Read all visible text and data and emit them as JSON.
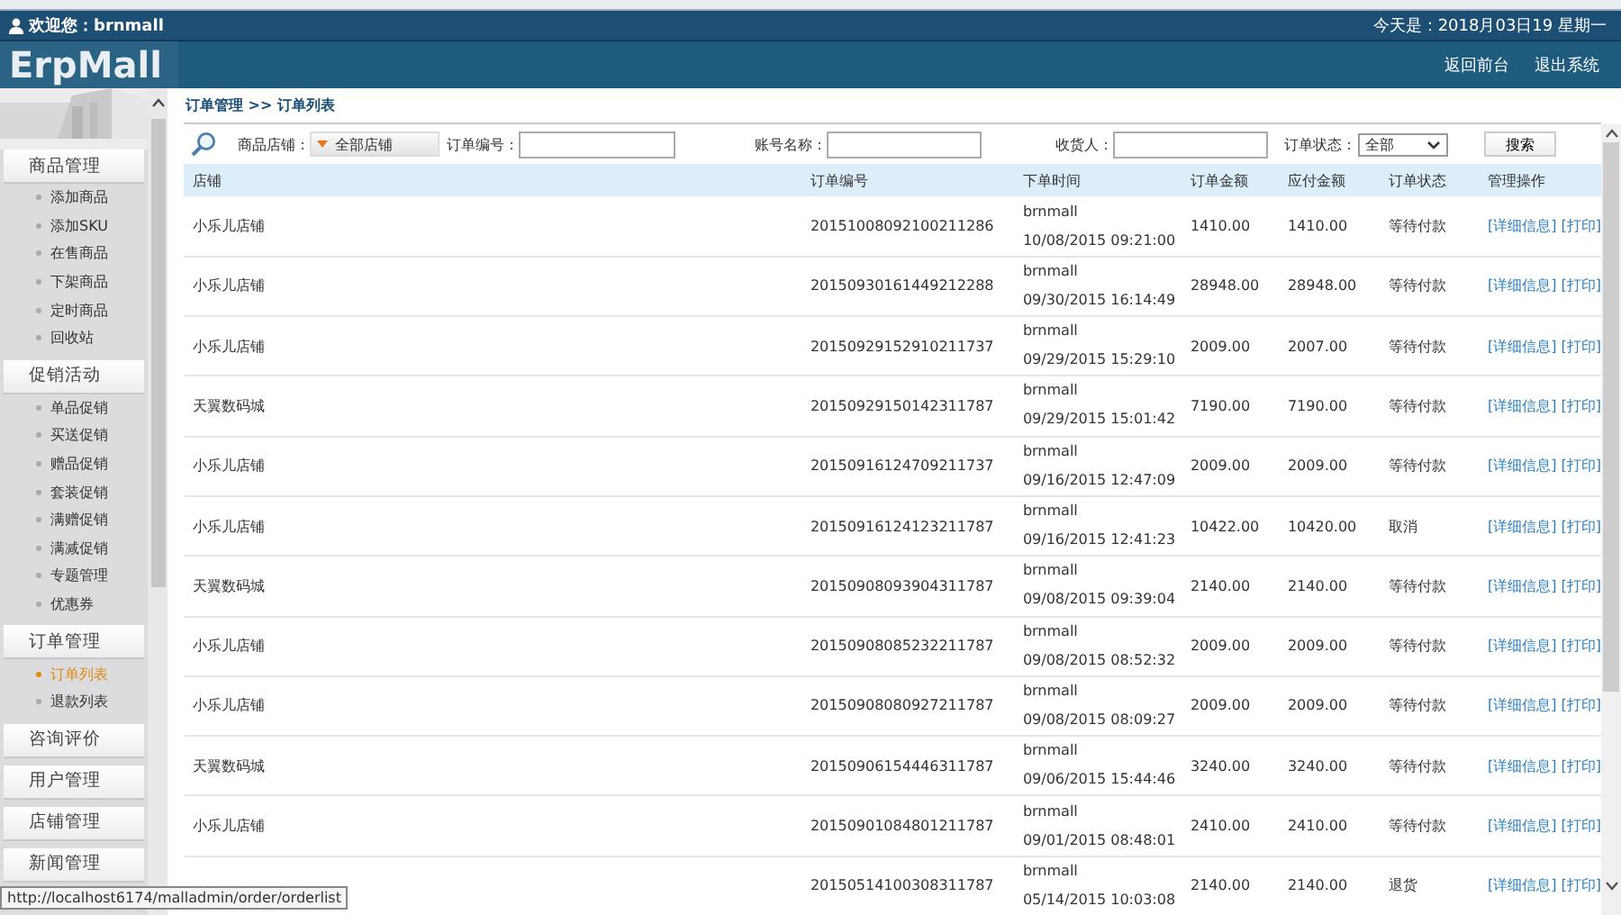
{
  "top_bar": {
    "welcome": "欢迎您：brnmall",
    "date": "今天是：2018月03日19 星期一"
  },
  "header": {
    "logo": "ErpMall",
    "links": [
      "返回前台",
      "退出系统"
    ]
  },
  "sidebar": {
    "groups": [
      {
        "title": "商品管理",
        "items": [
          {
            "label": "添加商品",
            "selected": false
          },
          {
            "label": "添加SKU",
            "selected": false
          },
          {
            "label": "在售商品",
            "selected": false
          },
          {
            "label": "下架商品",
            "selected": false
          },
          {
            "label": "定时商品",
            "selected": false
          },
          {
            "label": "回收站",
            "selected": false
          }
        ]
      },
      {
        "title": "促销活动",
        "items": [
          {
            "label": "单品促销",
            "selected": false
          },
          {
            "label": "买送促销",
            "selected": false
          },
          {
            "label": "赠品促销",
            "selected": false
          },
          {
            "label": "套装促销",
            "selected": false
          },
          {
            "label": "满赠促销",
            "selected": false
          },
          {
            "label": "满减促销",
            "selected": false
          },
          {
            "label": "专题管理",
            "selected": false
          },
          {
            "label": "优惠券",
            "selected": false
          }
        ]
      },
      {
        "title": "订单管理",
        "items": [
          {
            "label": "订单列表",
            "selected": true
          },
          {
            "label": "退款列表",
            "selected": false
          }
        ]
      },
      {
        "title": "咨询评价"
      },
      {
        "title": "用户管理"
      },
      {
        "title": "店铺管理"
      },
      {
        "title": "新闻管理"
      }
    ]
  },
  "breadcrumb": "订单管理 >> 订单列表",
  "filters": {
    "store_label": "商品店铺：",
    "store_value": "全部店铺",
    "order_no_label": "订单编号：",
    "account_label": "账号名称：",
    "consignee_label": "收货人：",
    "status_label": "订单状态：",
    "status_value": "全部",
    "search_button": "搜索"
  },
  "table": {
    "columns": [
      "店铺",
      "订单编号",
      "下单时间",
      "订单金额",
      "应付金额",
      "订单状态",
      "管理操作"
    ],
    "rows": [
      {
        "shop": "小乐儿店铺",
        "order_no": "20151008092100211286",
        "buyer": "brnmall",
        "time": "10/08/2015 09:21:00",
        "amount": "1410.00",
        "payable": "1410.00",
        "status": "等待付款",
        "actions": [
          "[详细信息]",
          "[打印]"
        ]
      },
      {
        "shop": "小乐儿店铺",
        "order_no": "20150930161449212288",
        "buyer": "brnmall",
        "time": "09/30/2015 16:14:49",
        "amount": "28948.00",
        "payable": "28948.00",
        "status": "等待付款",
        "actions": [
          "[详细信息]",
          "[打印]"
        ]
      },
      {
        "shop": "小乐儿店铺",
        "order_no": "20150929152910211737",
        "buyer": "brnmall",
        "time": "09/29/2015 15:29:10",
        "amount": "2009.00",
        "payable": "2007.00",
        "status": "等待付款",
        "actions": [
          "[详细信息]",
          "[打印]"
        ]
      },
      {
        "shop": "天翼数码城",
        "order_no": "20150929150142311787",
        "buyer": "brnmall",
        "time": "09/29/2015 15:01:42",
        "amount": "7190.00",
        "payable": "7190.00",
        "status": "等待付款",
        "actions": [
          "[详细信息]",
          "[打印]"
        ]
      },
      {
        "shop": "小乐儿店铺",
        "order_no": "20150916124709211737",
        "buyer": "brnmall",
        "time": "09/16/2015 12:47:09",
        "amount": "2009.00",
        "payable": "2009.00",
        "status": "等待付款",
        "actions": [
          "[详细信息]",
          "[打印]"
        ]
      },
      {
        "shop": "小乐儿店铺",
        "order_no": "20150916124123211787",
        "buyer": "brnmall",
        "time": "09/16/2015 12:41:23",
        "amount": "10422.00",
        "payable": "10420.00",
        "status": "取消",
        "actions": [
          "[详细信息]",
          "[打印]"
        ]
      },
      {
        "shop": "天翼数码城",
        "order_no": "20150908093904311787",
        "buyer": "brnmall",
        "time": "09/08/2015 09:39:04",
        "amount": "2140.00",
        "payable": "2140.00",
        "status": "等待付款",
        "actions": [
          "[详细信息]",
          "[打印]"
        ]
      },
      {
        "shop": "小乐儿店铺",
        "order_no": "20150908085232211787",
        "buyer": "brnmall",
        "time": "09/08/2015 08:52:32",
        "amount": "2009.00",
        "payable": "2009.00",
        "status": "等待付款",
        "actions": [
          "[详细信息]",
          "[打印]"
        ]
      },
      {
        "shop": "小乐儿店铺",
        "order_no": "20150908080927211787",
        "buyer": "brnmall",
        "time": "09/08/2015 08:09:27",
        "amount": "2009.00",
        "payable": "2009.00",
        "status": "等待付款",
        "actions": [
          "[详细信息]",
          "[打印]"
        ]
      },
      {
        "shop": "天翼数码城",
        "order_no": "20150906154446311787",
        "buyer": "brnmall",
        "time": "09/06/2015 15:44:46",
        "amount": "3240.00",
        "payable": "3240.00",
        "status": "等待付款",
        "actions": [
          "[详细信息]",
          "[打印]"
        ]
      },
      {
        "shop": "小乐儿店铺",
        "order_no": "20150901084801211787",
        "buyer": "brnmall",
        "time": "09/01/2015 08:48:01",
        "amount": "2410.00",
        "payable": "2410.00",
        "status": "等待付款",
        "actions": [
          "[详细信息]",
          "[打印]"
        ]
      },
      {
        "order_no": "20150514100308311787",
        "buyer": "brnmall",
        "time": "05/14/2015 10:03:08",
        "amount": "2140.00",
        "payable": "2140.00",
        "status": "退货",
        "actions": [
          "[详细信息]",
          "[打印]"
        ]
      }
    ]
  },
  "status_url": "http://localhost6174/malladmin/order/orderlist"
}
